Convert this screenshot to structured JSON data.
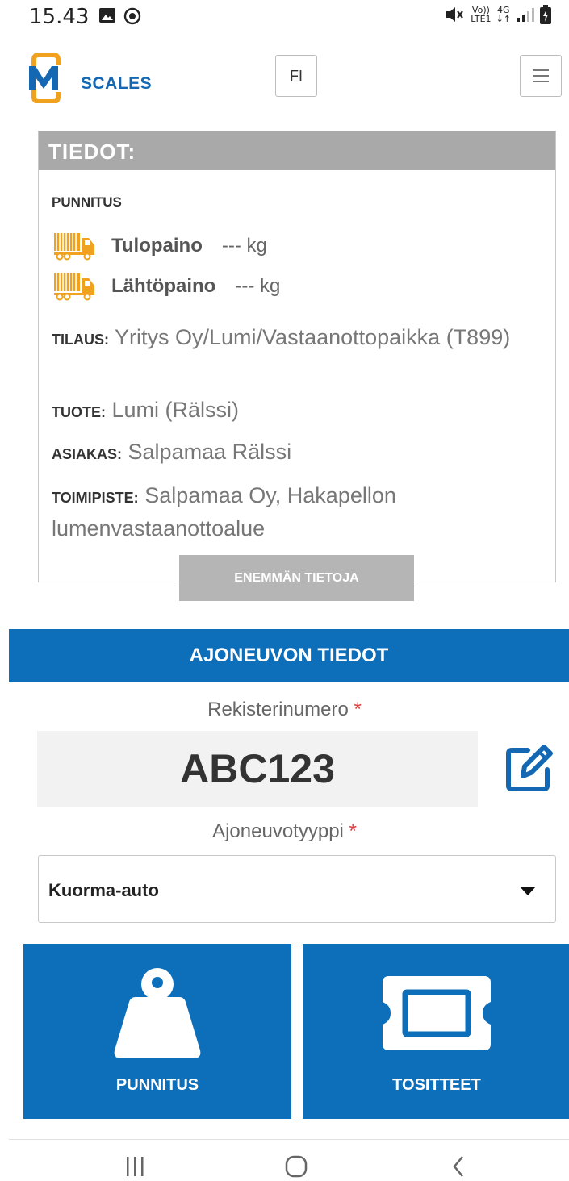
{
  "status_bar": {
    "time": "15.43",
    "network_top": "Vo))",
    "network_bottom": "LTE1",
    "network_type": "4G",
    "icons": [
      "image-icon",
      "record-icon",
      "mute-icon",
      "signal-icon",
      "battery-icon"
    ]
  },
  "header": {
    "logo_letter": "M",
    "logo_text": "SCALES",
    "language_button": "FI",
    "menu_icon": "hamburger-icon"
  },
  "info": {
    "title": "TIEDOT:",
    "section_label": "PUNNITUS",
    "weights": [
      {
        "label": "Tulopaino",
        "value": "--- kg"
      },
      {
        "label": "Lähtöpaino",
        "value": "--- kg"
      }
    ],
    "details": [
      {
        "key": "TILAUS:",
        "value": "Yritys Oy/Lumi/Vastaanottopaikka (T899)"
      },
      {
        "key": "TUOTE:",
        "value": "Lumi (Rälssi)"
      },
      {
        "key": "ASIAKAS:",
        "value": "Salpamaa Rälssi"
      },
      {
        "key": "TOIMIPISTE:",
        "value": "Salpamaa Oy, Hakapellon lumenvastaanottoalue"
      }
    ],
    "more_button": "ENEMMÄN TIETOJA"
  },
  "vehicle": {
    "title": "AJONEUVON TIEDOT",
    "plate_label": "Rekisterinumero",
    "required_mark": "*",
    "plate_value": "ABC123",
    "type_label": "Ajoneuvotyyppi",
    "type_value": "Kuorma-auto"
  },
  "tiles": [
    {
      "label": "PUNNITUS",
      "icon": "weight-icon"
    },
    {
      "label": "TOSITTEET",
      "icon": "ticket-icon"
    }
  ],
  "colors": {
    "primary_blue": "#0d6eb9",
    "truck_orange": "#f0a21f",
    "header_gray": "#a9a9a9",
    "required_red": "#e03a3a"
  }
}
